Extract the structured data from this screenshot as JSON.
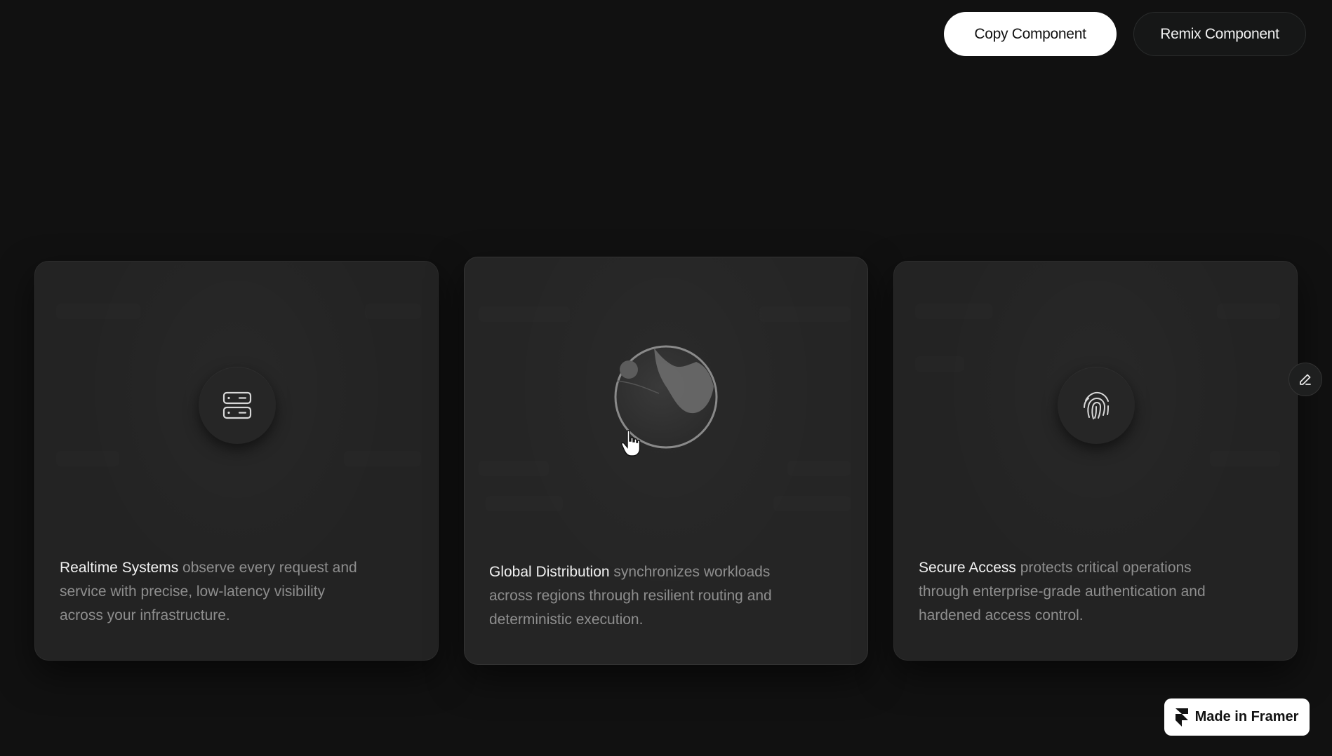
{
  "top_actions": {
    "copy_label": "Copy Component",
    "remix_label": "Remix Component"
  },
  "cards": [
    {
      "title": "Realtime Systems",
      "description": " observe every request and service with precise, low-latency visibility across your infrastructure.",
      "icon": "server-icon"
    },
    {
      "title": "Global Distribution",
      "description": " synchronizes workloads across regions through resilient routing and deterministic execution.",
      "icon": "globe-icon"
    },
    {
      "title": "Secure Access",
      "description": " protects critical operations through enterprise-grade authentication and hardened access control.",
      "icon": "fingerprint-icon"
    }
  ],
  "badge": {
    "label": "Made in Framer",
    "icon": "framer-logo-icon"
  },
  "colors": {
    "background": "#111111",
    "card": "#232323",
    "text_muted": "#8e8e8e",
    "text_strong": "#f1f1f1"
  }
}
